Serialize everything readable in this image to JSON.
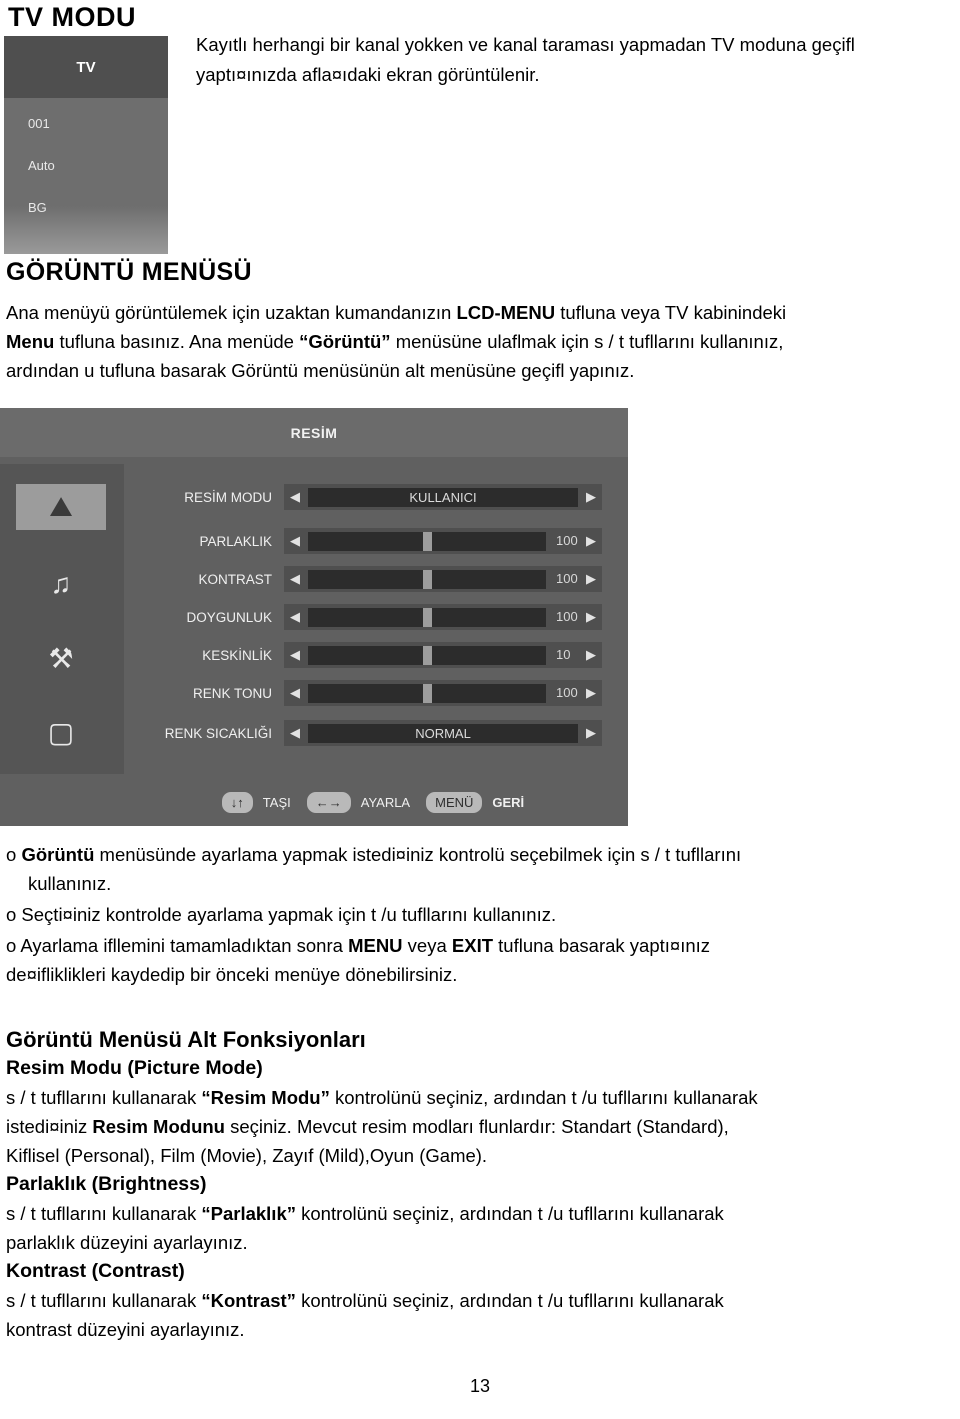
{
  "document": {
    "title": "TV MODU",
    "page_number": "13"
  },
  "tv_osd": {
    "badge": "TV",
    "channel": "001",
    "mode": "Auto",
    "system": "BG"
  },
  "intro": {
    "text": "Kayıtlı herhangi bir kanal yokken ve kanal taraması yapmadan TV moduna geçifl yaptı¤ınızda afla¤ıdaki ekran görüntülenir."
  },
  "section": {
    "heading": "GÖRÜNTÜ MENÜSÜ",
    "line1_a": "Ana menüyü görüntülemek için uzaktan kumandanızın ",
    "line1_b": "LCD-MENU",
    "line1_c": " tufluna veya TV kabinindeki ",
    "line2_a": "Menu",
    "line2_b": " tufluna basınız. Ana menüde ",
    "line2_c": "“Görüntü”",
    "line2_d": " menüsüne ulaflmak için  s  / t  tufllarını kullanınız,",
    "line3": "ardından u  tufluna basarak Görüntü menüsünün alt menüsüne geçifl yapınız."
  },
  "osd": {
    "header": "RESİM",
    "icons": [
      {
        "name": "picture-icon",
        "glyph": "⛰"
      },
      {
        "name": "sound-icon",
        "glyph": "♫"
      },
      {
        "name": "feature-icon",
        "glyph": "⚒"
      },
      {
        "name": "tv-icon",
        "glyph": "▢"
      }
    ],
    "rows": [
      {
        "label": "RESİM MODU",
        "type": "select",
        "value": "KULLANICI"
      },
      {
        "label": "PARLAKLIK",
        "type": "slider",
        "value": "100",
        "percent": 50
      },
      {
        "label": "KONTRAST",
        "type": "slider",
        "value": "100",
        "percent": 50
      },
      {
        "label": "DOYGUNLUK",
        "type": "slider",
        "value": "100",
        "percent": 50
      },
      {
        "label": "KESKİNLİK",
        "type": "slider",
        "value": "10",
        "percent": 50
      },
      {
        "label": "RENK TONU",
        "type": "slider",
        "value": "100",
        "percent": 50
      },
      {
        "label": "RENK SICAKLIĞI",
        "type": "select",
        "value": "NORMAL"
      }
    ],
    "footer": {
      "updown_keys": "↓↑",
      "updown_label": "TAŞI",
      "leftright_keys": "←→",
      "leftright_label": "AYARLA",
      "menu_key": "MENÜ",
      "menu_label": "GERİ"
    }
  },
  "bullets": {
    "b1_a": "o ",
    "b1_b": "Görüntü",
    "b1_c": " menüsünde ayarlama yapmak istedi¤iniz kontrolü seçebilmek için  s  / t  tufllarını",
    "b1_d": "kullanınız.",
    "b2": "o Seçti¤iniz kontrolde ayarlama yapmak için t  /u  tufllarını kullanınız.",
    "b3_a": "o Ayarlama ifllemini tamamladıktan sonra ",
    "b3_b": "MENU",
    "b3_c": " veya ",
    "b3_d": "EXIT",
    "b3_e": " tufluna basarak yaptı¤ınız",
    "b3_f": "de¤ifliklikleri kaydedip bir önceki menüye dönebilirsiniz."
  },
  "subfunctions": {
    "heading": "Görüntü Menüsü Alt Fonksiyonları",
    "items": [
      {
        "title": "Resim Modu (Picture Mode)",
        "p1_a": "s  / t  tufllarını kullanarak ",
        "p1_b": "“Resim Modu”",
        "p1_c": " kontrolünü seçiniz, ardından t  /u  tufllarını kullanarak",
        "p2_a": "istedi¤iniz ",
        "p2_b": "Resim Modunu",
        "p2_c": " seçiniz. Mevcut resim modları flunlardır: Standart  (Standard),",
        "p3": "Kiflisel (Personal), Film (Movie), Zayıf (Mild),Oyun (Game)."
      },
      {
        "title": "Parlaklık (Brightness)",
        "p1_a": "s  / t  tufllarını kullanarak ",
        "p1_b": "“Parlaklık”",
        "p1_c": " kontrolünü seçiniz, ardından t  /u  tufllarını kullanarak",
        "p2": "parlaklık düzeyini ayarlayınız."
      },
      {
        "title": "Kontrast (Contrast)",
        "p1_a": "s  / t  tufllarını kullanarak ",
        "p1_b": "“Kontrast”",
        "p1_c": " kontrolünü seçiniz, ardından t  /u  tufllarını kullanarak",
        "p2": "kontrast düzeyini ayarlayınız."
      }
    ]
  }
}
